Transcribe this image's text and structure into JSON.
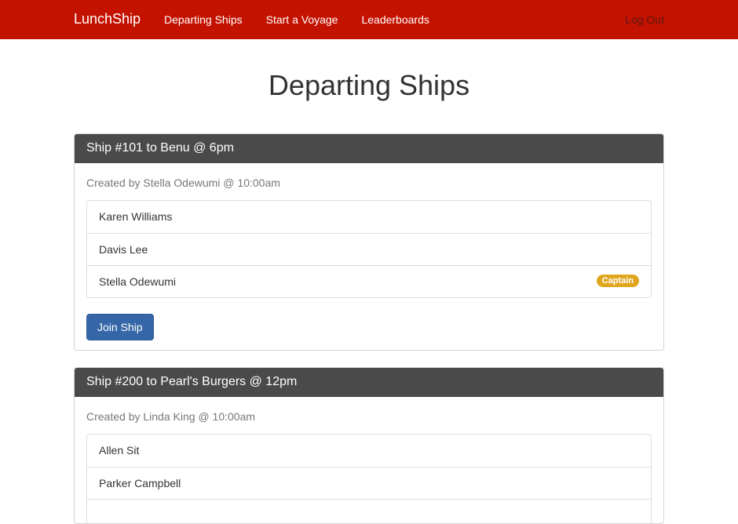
{
  "nav": {
    "brand": "LunchShip",
    "links": [
      "Departing Ships",
      "Start a Voyage",
      "Leaderboards"
    ],
    "logout": "Log Out"
  },
  "page": {
    "title": "Departing Ships"
  },
  "ships": [
    {
      "heading": "Ship #101 to Benu @ 6pm",
      "created": "Created by Stella Odewumi @ 10:00am",
      "crew": [
        "Karen Williams",
        "Davis Lee",
        "Stella Odewumi"
      ],
      "badge": "Captain",
      "join_label": "Join Ship"
    },
    {
      "heading": "Ship #200 to Pearl's Burgers @ 12pm",
      "created": "Created by Linda King @ 10:00am",
      "crew": [
        "Allen Sit",
        "Parker Campbell"
      ]
    }
  ],
  "colors": {
    "navbar": "#c41200",
    "panel_heading": "#4a4a4a",
    "captain_badge": "#e0a61e",
    "primary_button": "#3567a8"
  }
}
